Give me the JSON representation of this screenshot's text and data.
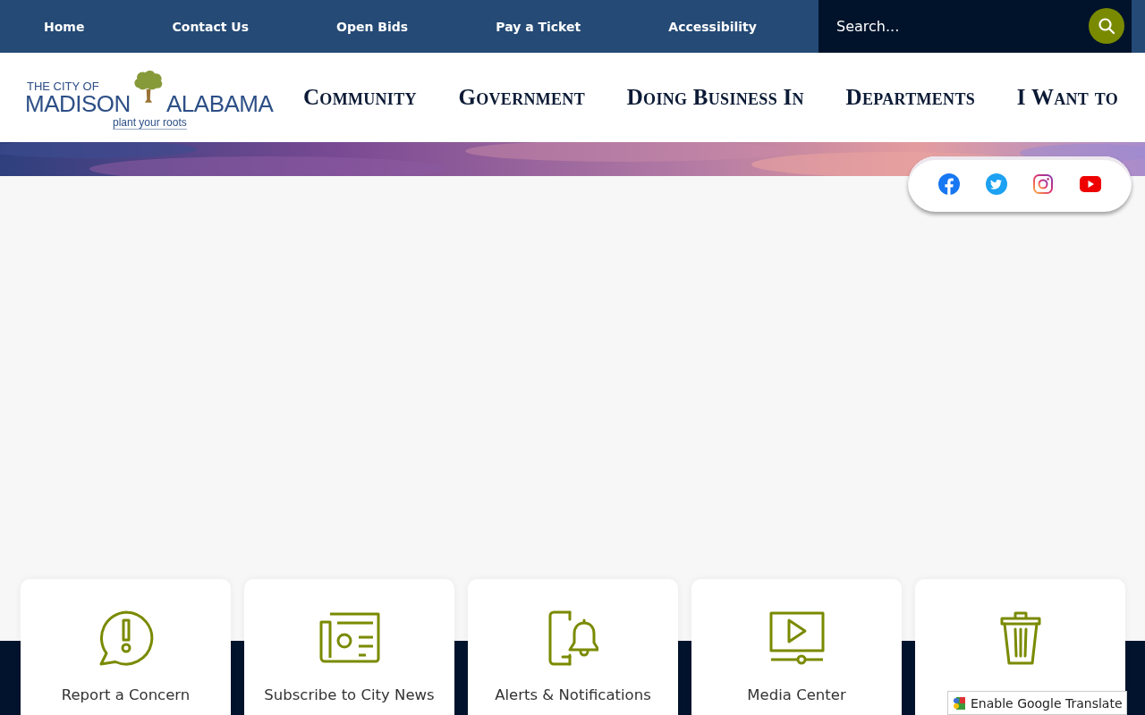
{
  "top_nav": [
    {
      "label": "Home"
    },
    {
      "label": "Contact Us"
    },
    {
      "label": "Open Bids"
    },
    {
      "label": "Pay a Ticket"
    },
    {
      "label": "Accessibility"
    }
  ],
  "search": {
    "placeholder": "Search..."
  },
  "logo": {
    "line_1": "THE CITY OF",
    "left_word": "MADISON",
    "right_word": "ALABAMA",
    "tagline": "plant your roots"
  },
  "main_nav": [
    {
      "label": "Community"
    },
    {
      "label": "Government"
    },
    {
      "label": "Doing Business In"
    },
    {
      "label": "Departments"
    },
    {
      "label": "I Want to"
    }
  ],
  "quick_links": [
    {
      "kind": "alert",
      "label": "Report a Concern"
    },
    {
      "kind": "newspaper",
      "label": "Subscribe to City News"
    },
    {
      "kind": "phone-bell",
      "label": "Alerts & Notifications"
    },
    {
      "kind": "video",
      "label": "Media Center"
    },
    {
      "kind": "trash"
    }
  ],
  "translate": {
    "label": "Enable Google Translate"
  }
}
